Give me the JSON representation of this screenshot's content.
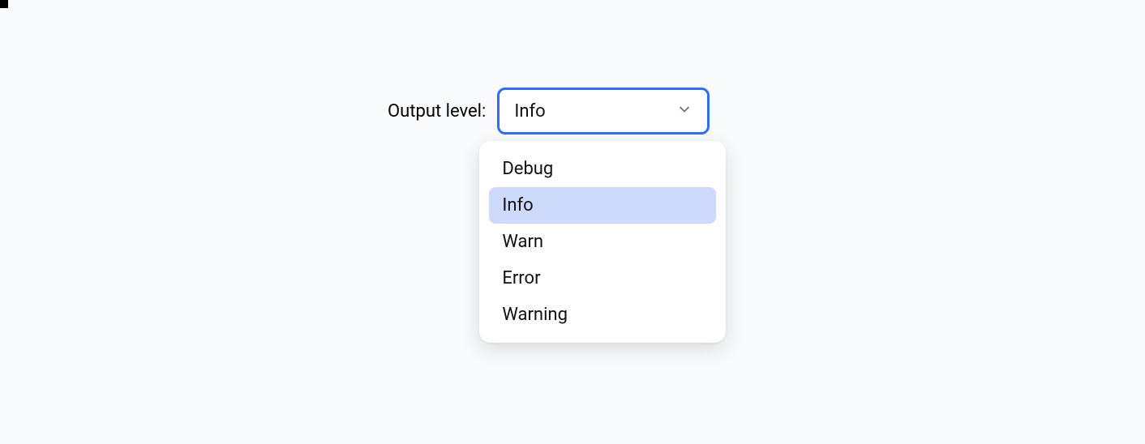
{
  "field": {
    "label": "Output level:",
    "selected": "Info",
    "options": [
      {
        "label": "Debug",
        "selected": false
      },
      {
        "label": "Info",
        "selected": true
      },
      {
        "label": "Warn",
        "selected": false
      },
      {
        "label": "Error",
        "selected": false
      },
      {
        "label": "Warning",
        "selected": false
      }
    ]
  }
}
